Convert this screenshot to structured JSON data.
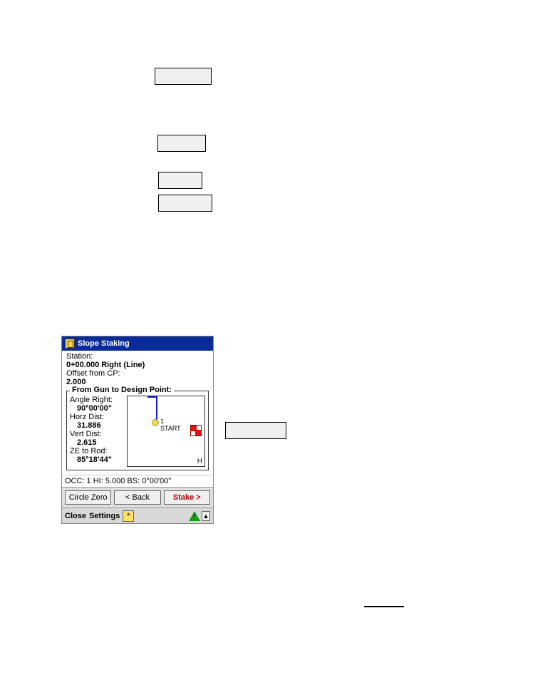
{
  "buttons": {
    "b1": "",
    "b2": "",
    "b3": "",
    "b4": "",
    "b5": ""
  },
  "device": {
    "title": "Slope Staking",
    "station_label": "Station:",
    "station_value": "0+00.000  Right  (Line)",
    "offset_label": "Offset from CP:",
    "offset_value": "2.000",
    "group_title": "From Gun to Design Point:",
    "angle_right_label": "Angle Right:",
    "angle_right_value": "90°00'00\"",
    "horz_label": "Horz Dist:",
    "horz_value": "31.886",
    "vert_label": "Vert Dist:",
    "vert_value": "2.615",
    "ze_label": "ZE to Rod:",
    "ze_value": "85°18'44\"",
    "map_marker_num": "1",
    "map_marker_text": "START",
    "map_h": "H",
    "status": "OCC: 1  HI: 5.000  BS: 0°00'00\"",
    "btn_circle": "Circle Zero",
    "btn_back": "< Back",
    "btn_stake": "Stake >",
    "bb_close": "Close",
    "bb_settings": "Settings",
    "star": "*",
    "up": "▲"
  }
}
